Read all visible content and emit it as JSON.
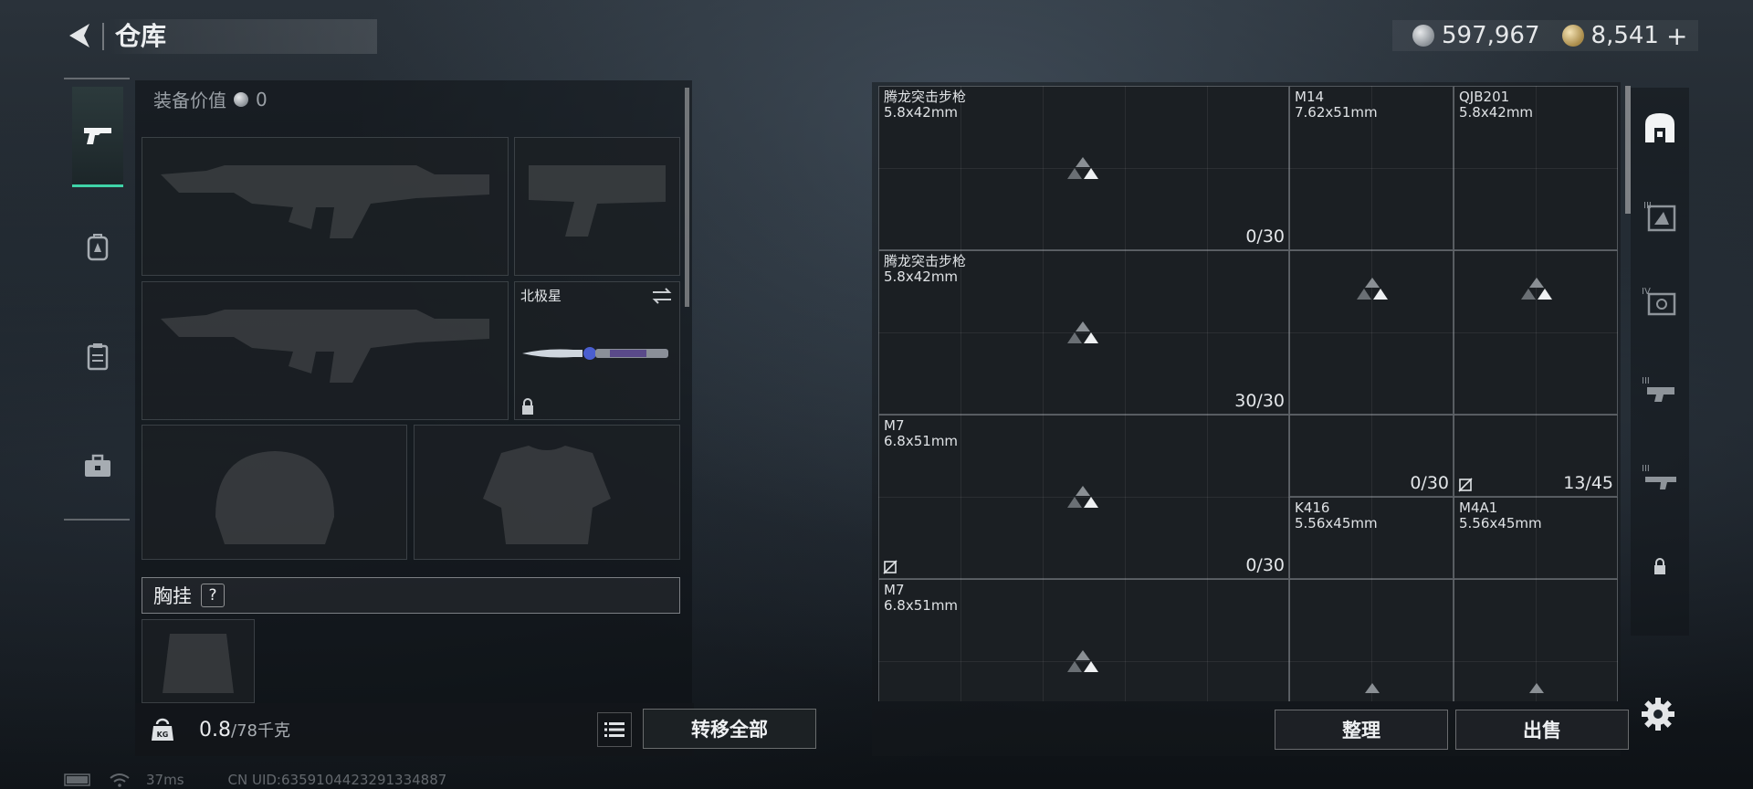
{
  "header": {
    "title": "仓库"
  },
  "currency": {
    "silver": "597,967",
    "gold": "8,541",
    "gold_plus": "+"
  },
  "left_tabs": [
    {
      "icon": "pistol-icon",
      "active": true
    },
    {
      "icon": "backpack-icon",
      "active": false
    },
    {
      "icon": "clipboard-icon",
      "active": false
    },
    {
      "icon": "toolbox-icon",
      "active": false
    }
  ],
  "equipment": {
    "value_label": "装备价值",
    "value": "0",
    "knife_name": "北极星",
    "chest_label": "胸挂",
    "chest_help": "?"
  },
  "weight": {
    "current": "0.8",
    "max": "/78千克"
  },
  "buttons": {
    "transfer_all": "转移全部",
    "sort": "整理",
    "sell": "出售"
  },
  "status": {
    "latency": "37ms",
    "uid": "CN UID:6359104423291334887"
  },
  "storage_items": [
    {
      "name": "腾龙突击步枪",
      "caliber": "5.8x42mm",
      "count": "0/30"
    },
    {
      "name": "M14",
      "caliber": "7.62x51mm",
      "count": ""
    },
    {
      "name": "QJB201",
      "caliber": "5.8x42mm",
      "count": ""
    },
    {
      "name": "腾龙突击步枪",
      "caliber": "5.8x42mm",
      "count": "30/30"
    },
    {
      "name": "",
      "caliber": "",
      "count": ""
    },
    {
      "name": "",
      "caliber": "",
      "count": ""
    },
    {
      "name": "M7",
      "caliber": "6.8x51mm",
      "count": "0/30"
    },
    {
      "name": "",
      "caliber": "",
      "count": "0/30"
    },
    {
      "name": "",
      "caliber": "",
      "count": "13/45"
    },
    {
      "name": "K416",
      "caliber": "5.56x45mm",
      "count": ""
    },
    {
      "name": "M4A1",
      "caliber": "5.56x45mm",
      "count": ""
    },
    {
      "name": "M7",
      "caliber": "6.8x51mm",
      "count": ""
    }
  ],
  "right_tabs": [
    {
      "icon": "storage-icon",
      "active": true
    },
    {
      "icon": "armor-level-iii-icon",
      "active": false
    },
    {
      "icon": "gear-level-iv-icon",
      "active": false
    },
    {
      "icon": "gear-level-iii-icon",
      "active": false
    },
    {
      "icon": "weapon-level-iii-icon",
      "active": false
    },
    {
      "icon": "lock-icon",
      "active": false
    }
  ],
  "colors": {
    "accent": "#3fd3a8",
    "background": "#1d242b"
  }
}
